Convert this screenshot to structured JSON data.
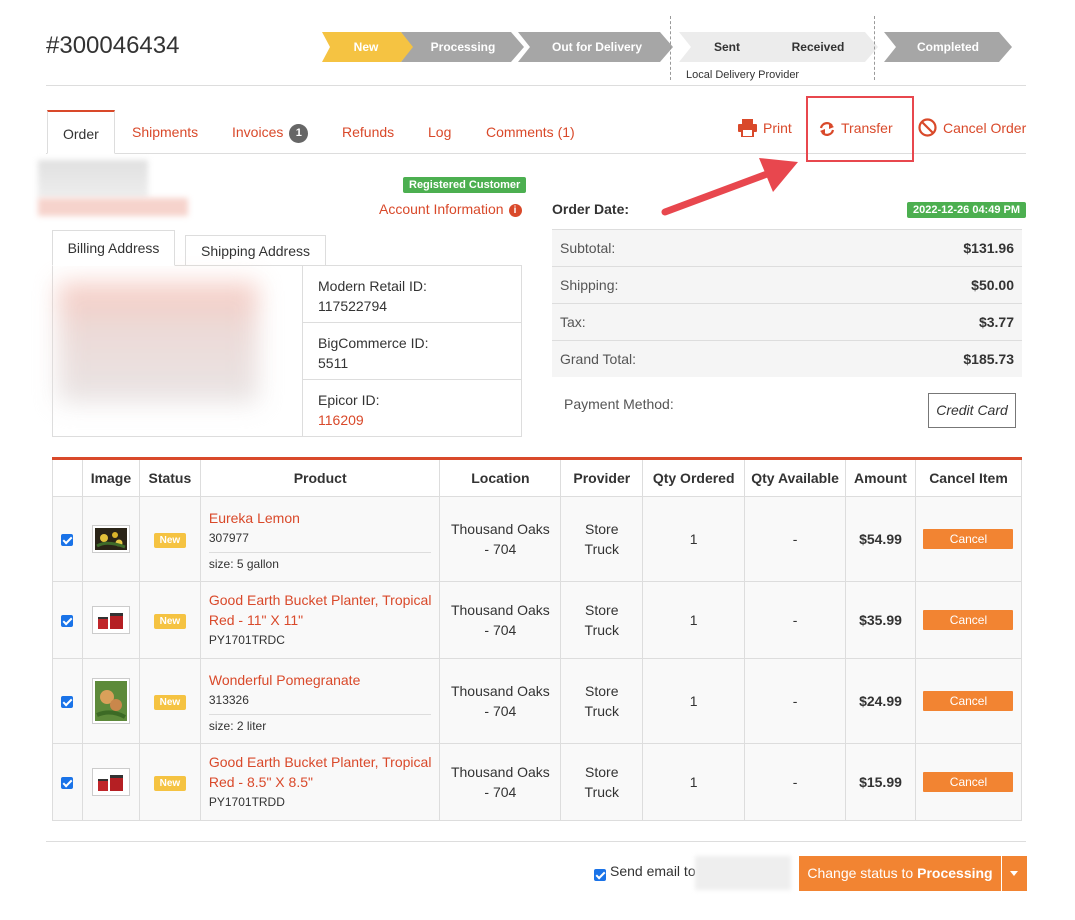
{
  "order": {
    "number": "#300046434"
  },
  "pipeline": {
    "steps": [
      "New",
      "Processing",
      "Out for Delivery",
      "Sent",
      "Received",
      "Completed"
    ],
    "caption": "Local Delivery Provider",
    "colors": {
      "active": "#f5c342",
      "done": "#a6a6a6",
      "pending": "#ececec"
    }
  },
  "tabs": {
    "order": "Order",
    "shipments": "Shipments",
    "invoices": "Invoices",
    "invoices_count": "1",
    "refunds": "Refunds",
    "log": "Log",
    "comments": "Comments (1)"
  },
  "actions": {
    "print": "Print",
    "transfer": "Transfer",
    "cancel_order": "Cancel Order"
  },
  "customer": {
    "badge": "Registered Customer",
    "account_info": "Account Information",
    "info_icon": "i"
  },
  "address": {
    "billing_tab": "Billing Address",
    "shipping_tab": "Shipping Address",
    "ids": [
      {
        "label": "Modern Retail ID:",
        "value": "117522794"
      },
      {
        "label": "BigCommerce ID:",
        "value": "5511"
      },
      {
        "label": "Epicor ID:",
        "value": "116209"
      }
    ]
  },
  "summary": {
    "order_date_label": "Order Date:",
    "order_date": "2022-12-26 04:49 PM",
    "rows": [
      {
        "label": "Subtotal:",
        "value": "$131.96"
      },
      {
        "label": "Shipping:",
        "value": "$50.00"
      },
      {
        "label": "Tax:",
        "value": "$3.77"
      },
      {
        "label": "Grand Total:",
        "value": "$185.73"
      }
    ],
    "payment_label": "Payment Method:",
    "payment_value": "Credit Card"
  },
  "items": {
    "headers": [
      "Image",
      "Status",
      "Product",
      "Location",
      "Provider",
      "Qty Ordered",
      "Qty Available",
      "Amount",
      "Cancel Item"
    ],
    "rows": [
      {
        "status": "New",
        "name": "Eureka Lemon",
        "sku": "307977",
        "size": "size: 5 gallon",
        "location_1": "Thousand Oaks",
        "location_2": "- 704",
        "provider_1": "Store",
        "provider_2": "Truck",
        "qty": "1",
        "available": "-",
        "amount": "$54.99",
        "cancel": "Cancel"
      },
      {
        "status": "New",
        "name": "Good Earth Bucket Planter, Tropical Red - 11\" X 11\"",
        "sku": "PY1701TRDC",
        "size": "",
        "location_1": "Thousand Oaks",
        "location_2": "- 704",
        "provider_1": "Store",
        "provider_2": "Truck",
        "qty": "1",
        "available": "-",
        "amount": "$35.99",
        "cancel": "Cancel"
      },
      {
        "status": "New",
        "name": "Wonderful Pomegranate",
        "sku": "313326",
        "size": "size: 2 liter",
        "location_1": "Thousand Oaks",
        "location_2": "- 704",
        "provider_1": "Store",
        "provider_2": "Truck",
        "qty": "1",
        "available": "-",
        "amount": "$24.99",
        "cancel": "Cancel"
      },
      {
        "status": "New",
        "name": "Good Earth Bucket Planter, Tropical Red - 8.5\" X 8.5\"",
        "sku": "PY1701TRDD",
        "size": "",
        "location_1": "Thousand Oaks",
        "location_2": "- 704",
        "provider_1": "Store",
        "provider_2": "Truck",
        "qty": "1",
        "available": "-",
        "amount": "$15.99",
        "cancel": "Cancel"
      }
    ]
  },
  "footer": {
    "send_email": "Send email to",
    "status_prefix": "Change status to",
    "status_target": "Processing"
  },
  "colors": {
    "accent": "#d9492a",
    "button": "#f28432",
    "success": "#4caf50",
    "annotation": "#e8474e"
  }
}
